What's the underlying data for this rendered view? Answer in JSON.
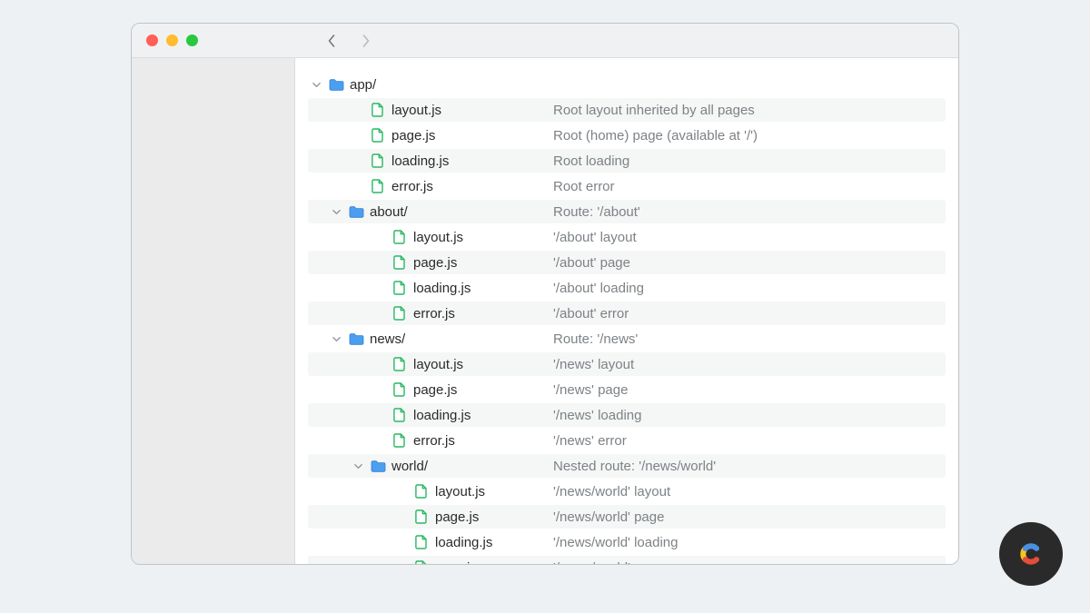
{
  "rows": [
    {
      "indent": 0,
      "type": "folder",
      "name": "app/",
      "desc": "",
      "alt": false
    },
    {
      "indent": 2,
      "type": "file",
      "name": "layout.js",
      "desc": "Root layout inherited by all pages",
      "alt": true
    },
    {
      "indent": 2,
      "type": "file",
      "name": "page.js",
      "desc": "Root (home) page (available at '/')",
      "alt": false
    },
    {
      "indent": 2,
      "type": "file",
      "name": "loading.js",
      "desc": "Root loading",
      "alt": true
    },
    {
      "indent": 2,
      "type": "file",
      "name": "error.js",
      "desc": "Root error",
      "alt": false
    },
    {
      "indent": 1,
      "type": "folder",
      "name": "about/",
      "desc": "Route: '/about'",
      "alt": true
    },
    {
      "indent": 3,
      "type": "file",
      "name": "layout.js",
      "desc": "'/about' layout",
      "alt": false
    },
    {
      "indent": 3,
      "type": "file",
      "name": "page.js",
      "desc": "'/about' page",
      "alt": true
    },
    {
      "indent": 3,
      "type": "file",
      "name": "loading.js",
      "desc": "'/about' loading",
      "alt": false
    },
    {
      "indent": 3,
      "type": "file",
      "name": "error.js",
      "desc": "'/about' error",
      "alt": true
    },
    {
      "indent": 1,
      "type": "folder",
      "name": "news/",
      "desc": "Route: '/news'",
      "alt": false
    },
    {
      "indent": 3,
      "type": "file",
      "name": "layout.js",
      "desc": "'/news' layout",
      "alt": true
    },
    {
      "indent": 3,
      "type": "file",
      "name": "page.js",
      "desc": "'/news' page",
      "alt": false
    },
    {
      "indent": 3,
      "type": "file",
      "name": "loading.js",
      "desc": "'/news' loading",
      "alt": true
    },
    {
      "indent": 3,
      "type": "file",
      "name": "error.js",
      "desc": "'/news' error",
      "alt": false
    },
    {
      "indent": 2,
      "type": "folder",
      "name": "world/",
      "desc": "Nested route: '/news/world'",
      "alt": true
    },
    {
      "indent": 4,
      "type": "file",
      "name": "layout.js",
      "desc": "'/news/world' layout",
      "alt": false
    },
    {
      "indent": 4,
      "type": "file",
      "name": "page.js",
      "desc": "'/news/world' page",
      "alt": true
    },
    {
      "indent": 4,
      "type": "file",
      "name": "loading.js",
      "desc": "'/news/world' loading",
      "alt": false
    },
    {
      "indent": 4,
      "type": "file",
      "name": "error.js",
      "desc": "'/news/world' error",
      "alt": true
    }
  ]
}
